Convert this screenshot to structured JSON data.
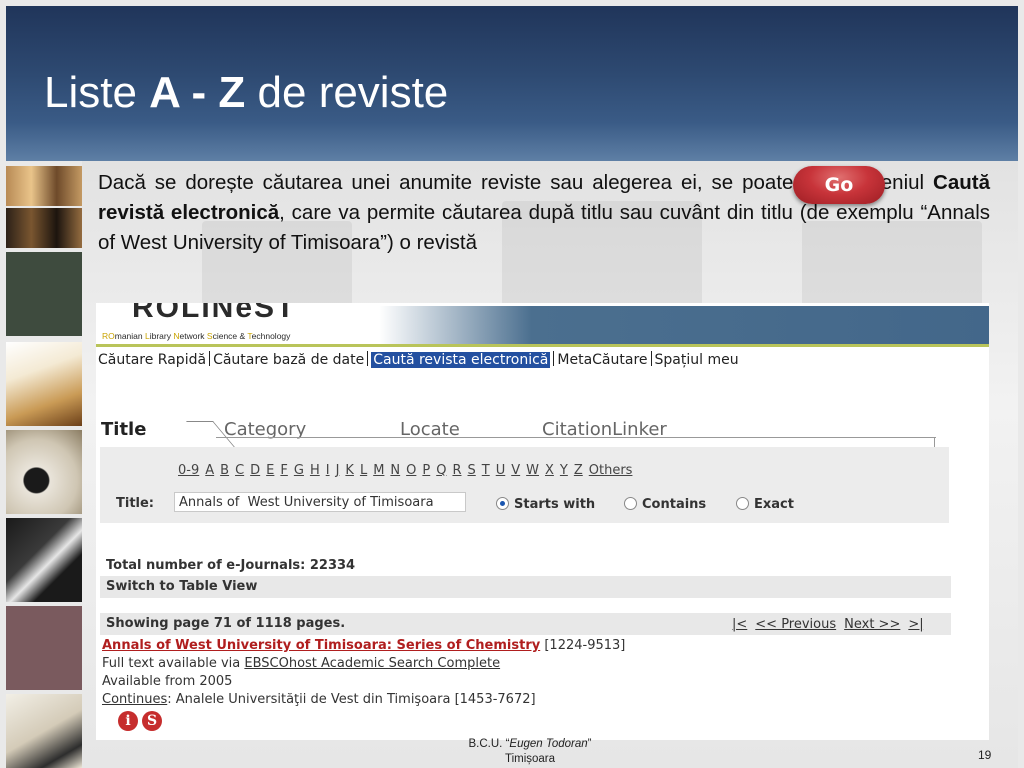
{
  "slide": {
    "title_pre": "Liste ",
    "title_bold": "A - Z",
    "title_post": " de reviste"
  },
  "description": {
    "part1": "Dacă se dorește căutarea unei anumite reviste sau alegerea ei, se poate utiliza meniul ",
    "bold": "Caută revistă electronică",
    "part2": ", care  va permite căutarea după titlu sau cuvânt din titlu (de exemplu “Annals of  West University of Timisoara”) o revistă"
  },
  "screenshot": {
    "logo": "ROLINeST",
    "tagline_parts": [
      "RO",
      "manian ",
      "L",
      "ibrary ",
      "N",
      "etwork ",
      "S",
      "cience & ",
      "T",
      "echnology"
    ],
    "nav": [
      {
        "label": "Căutare Rapidă"
      },
      {
        "label": "Căutare bază de date"
      },
      {
        "label": "Caută revista electronică",
        "active": true
      },
      {
        "label": "MetaCăutare"
      },
      {
        "label": "Spațiul meu"
      }
    ],
    "tabs": {
      "title": "Title",
      "category": "Category",
      "locate": "Locate",
      "citation": "CitationLinker"
    },
    "alphabet": [
      "0-9",
      "A",
      "B",
      "C",
      "D",
      "E",
      "F",
      "G",
      "H",
      "I",
      "J",
      "K",
      "L",
      "M",
      "N",
      "O",
      "P",
      "Q",
      "R",
      "S",
      "T",
      "U",
      "V",
      "W",
      "X",
      "Y",
      "Z",
      "Others"
    ],
    "title_label": "Title:",
    "title_value": "Annals of  West University of Timisoara",
    "options": {
      "starts": "Starts with",
      "contains": "Contains",
      "exact": "Exact"
    },
    "selected_option": "Starts with",
    "go_label": "Go",
    "total": "Total number of e-Journals: 22334",
    "switch_view": "Switch to Table View",
    "showing": "Showing page 71 of 1118 pages.",
    "pager": {
      "first": "|<",
      "prev": "<< Previous",
      "next": "Next >>",
      "last": ">|"
    },
    "result": {
      "title": "Annals of West University of Timisoara: Series of Chemistry",
      "issn": " [1224-9513]",
      "fulltext_prefix": "Full text available via ",
      "fulltext_link": "EBSCOhost Academic Search Complete",
      "available": "Available from 2005",
      "continues_label": "Continues",
      "continues_text": ": Analele Universităţii de Vest din Timişoara [1453-7672]"
    },
    "icons": {
      "info": "i",
      "sfx": "S"
    }
  },
  "footer": {
    "prefix": "B.C.U. “",
    "italic": "Eugen Todoran",
    "suffix": "”",
    "city": "Timișoara"
  },
  "page_number": "19",
  "colors": {
    "header": "#2e4a72",
    "accent_red": "#b01e1e",
    "go_button": "#c8343a",
    "nav_active": "#2350a0"
  }
}
